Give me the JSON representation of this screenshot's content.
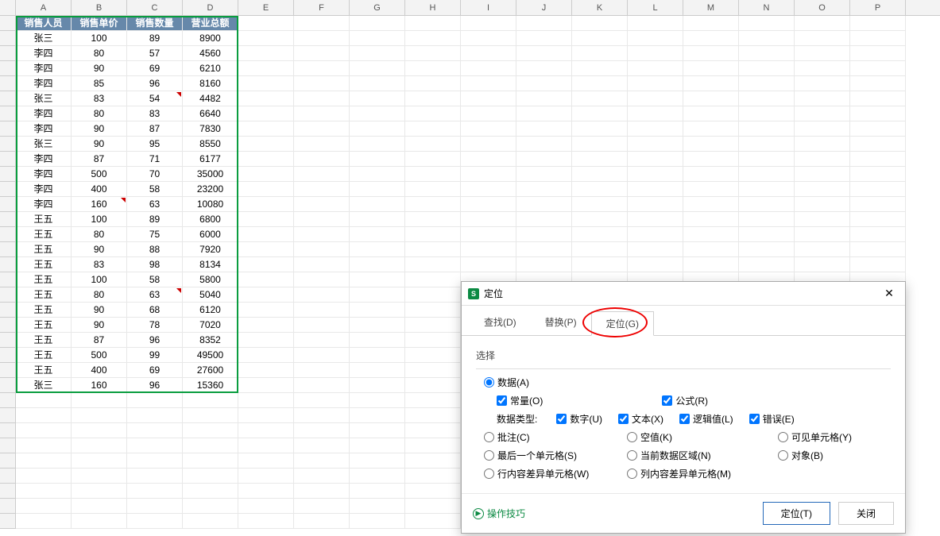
{
  "columns": [
    "A",
    "B",
    "C",
    "D",
    "E",
    "F",
    "G",
    "H",
    "I",
    "J",
    "K",
    "L",
    "M",
    "N",
    "O",
    "P"
  ],
  "table": {
    "headers": [
      "销售人员",
      "销售单价",
      "销售数量",
      "营业总额"
    ],
    "rows": [
      [
        "张三",
        "100",
        "89",
        "8900"
      ],
      [
        "李四",
        "80",
        "57",
        "4560"
      ],
      [
        "李四",
        "90",
        "69",
        "6210"
      ],
      [
        "李四",
        "85",
        "96",
        "8160"
      ],
      [
        "张三",
        "83",
        "54",
        "4482"
      ],
      [
        "李四",
        "80",
        "83",
        "6640"
      ],
      [
        "李四",
        "90",
        "87",
        "7830"
      ],
      [
        "张三",
        "90",
        "95",
        "8550"
      ],
      [
        "李四",
        "87",
        "71",
        "6177"
      ],
      [
        "李四",
        "500",
        "70",
        "35000"
      ],
      [
        "李四",
        "400",
        "58",
        "23200"
      ],
      [
        "李四",
        "160",
        "63",
        "10080"
      ],
      [
        "王五",
        "100",
        "89",
        "6800"
      ],
      [
        "王五",
        "80",
        "75",
        "6000"
      ],
      [
        "王五",
        "90",
        "88",
        "7920"
      ],
      [
        "王五",
        "83",
        "98",
        "8134"
      ],
      [
        "王五",
        "100",
        "58",
        "5800"
      ],
      [
        "王五",
        "80",
        "63",
        "5040"
      ],
      [
        "王五",
        "90",
        "68",
        "6120"
      ],
      [
        "王五",
        "90",
        "78",
        "7020"
      ],
      [
        "王五",
        "87",
        "96",
        "8352"
      ],
      [
        "王五",
        "500",
        "99",
        "49500"
      ],
      [
        "王五",
        "400",
        "69",
        "27600"
      ],
      [
        "张三",
        "160",
        "96",
        "15360"
      ]
    ],
    "redMarks": [
      [
        6,
        2
      ],
      [
        13,
        1
      ],
      [
        19,
        2
      ]
    ]
  },
  "dialog": {
    "title": "定位",
    "tabs": {
      "find": "查找(D)",
      "replace": "替换(P)",
      "goto": "定位(G)"
    },
    "sectionLabel": "选择",
    "opts": {
      "data": "数据(A)",
      "constants": "常量(O)",
      "formulas": "公式(R)",
      "typesLabel": "数据类型:",
      "number": "数字(U)",
      "text": "文本(X)",
      "logical": "逻辑值(L)",
      "error": "错误(E)",
      "comments": "批注(C)",
      "blanks": "空值(K)",
      "visible": "可见单元格(Y)",
      "lastCell": "最后一个单元格(S)",
      "currentRegion": "当前数据区域(N)",
      "objects": "对象(B)",
      "rowDiff": "行内容差异单元格(W)",
      "colDiff": "列内容差异单元格(M)"
    },
    "tips": "操作技巧",
    "btn": {
      "ok": "定位(T)",
      "close": "关闭"
    }
  }
}
